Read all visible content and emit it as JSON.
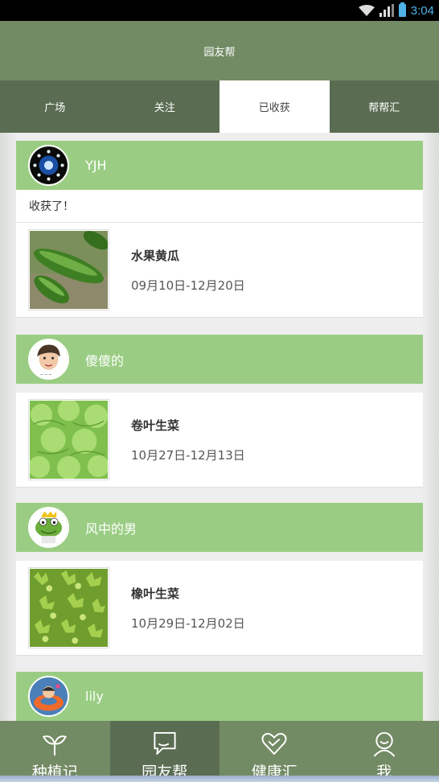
{
  "status_bar": {
    "time": "3:04"
  },
  "app": {
    "title": "园友帮"
  },
  "tabs": [
    {
      "label": "广场"
    },
    {
      "label": "关注"
    },
    {
      "label": "已收获"
    },
    {
      "label": "帮帮汇"
    }
  ],
  "feed": [
    {
      "username": "YJH",
      "message": "收获了！",
      "plant_name": "水果黄瓜",
      "period": "09月10日-12月20日",
      "image": "cucumber"
    },
    {
      "username": "傻傻的",
      "message": "",
      "plant_name": "卷叶生菜",
      "period": "10月27日-12月13日",
      "image": "lettuce"
    },
    {
      "username": "风中的男",
      "message": "",
      "plant_name": "橡叶生菜",
      "period": "10月29日-12月02日",
      "image": "oakleaf-lettuce"
    },
    {
      "username": "lily",
      "message": "",
      "plant_name": "",
      "period": "",
      "image": ""
    }
  ],
  "bottom_nav": [
    {
      "label": "种植记",
      "icon": "sprout-icon"
    },
    {
      "label": "园友帮",
      "icon": "chat-bubble-icon"
    },
    {
      "label": "健康汇",
      "icon": "heart-icon"
    },
    {
      "label": "我",
      "icon": "person-icon"
    }
  ],
  "colors": {
    "appbar": "#738b65",
    "tabbar": "#5a6d52",
    "card_header": "#9acd83",
    "status_accent": "#4fb3e8"
  }
}
